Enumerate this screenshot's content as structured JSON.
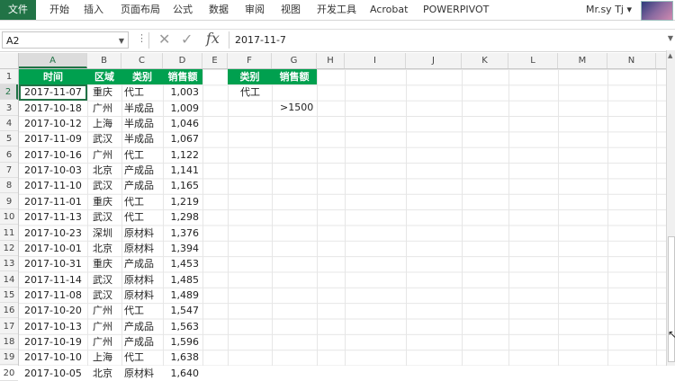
{
  "ribbon": {
    "file_tab": "文件",
    "tabs": [
      "开始",
      "插入",
      "页面布局",
      "公式",
      "数据",
      "审阅",
      "视图",
      "开发工具",
      "Acrobat",
      "POWERPIVOT"
    ],
    "user_name": "Mr.sy Tj",
    "user_caret": "▾",
    "accent_color": "#217346"
  },
  "formula_bar": {
    "name_box": "A2",
    "formula": "2017-11-7"
  },
  "columns": [
    "A",
    "B",
    "C",
    "D",
    "E",
    "F",
    "G",
    "H",
    "I",
    "J",
    "K",
    "L",
    "M",
    "N"
  ],
  "selected_column": "A",
  "selected_row": "2",
  "headers": {
    "time": "时间",
    "region": "区域",
    "category": "类别",
    "sales": "销售额",
    "criteria_category": "类别",
    "criteria_sales": "销售额"
  },
  "criteria": {
    "category_value": "代工",
    "sales_value": ">1500"
  },
  "rows": [
    {
      "n": "2",
      "date": "2017-11-07",
      "region": "重庆",
      "cat": "代工",
      "sales": "1,003"
    },
    {
      "n": "3",
      "date": "2017-10-18",
      "region": "广州",
      "cat": "半成品",
      "sales": "1,009"
    },
    {
      "n": "4",
      "date": "2017-10-12",
      "region": "上海",
      "cat": "半成品",
      "sales": "1,046"
    },
    {
      "n": "5",
      "date": "2017-11-09",
      "region": "武汉",
      "cat": "半成品",
      "sales": "1,067"
    },
    {
      "n": "6",
      "date": "2017-10-16",
      "region": "广州",
      "cat": "代工",
      "sales": "1,122"
    },
    {
      "n": "7",
      "date": "2017-10-03",
      "region": "北京",
      "cat": "产成品",
      "sales": "1,141"
    },
    {
      "n": "8",
      "date": "2017-11-10",
      "region": "武汉",
      "cat": "产成品",
      "sales": "1,165"
    },
    {
      "n": "9",
      "date": "2017-11-01",
      "region": "重庆",
      "cat": "代工",
      "sales": "1,219"
    },
    {
      "n": "10",
      "date": "2017-11-13",
      "region": "武汉",
      "cat": "代工",
      "sales": "1,298"
    },
    {
      "n": "11",
      "date": "2017-10-23",
      "region": "深圳",
      "cat": "原材料",
      "sales": "1,376"
    },
    {
      "n": "12",
      "date": "2017-10-01",
      "region": "北京",
      "cat": "原材料",
      "sales": "1,394"
    },
    {
      "n": "13",
      "date": "2017-10-31",
      "region": "重庆",
      "cat": "产成品",
      "sales": "1,453"
    },
    {
      "n": "14",
      "date": "2017-11-14",
      "region": "武汉",
      "cat": "原材料",
      "sales": "1,485"
    },
    {
      "n": "15",
      "date": "2017-11-08",
      "region": "武汉",
      "cat": "原材料",
      "sales": "1,489"
    },
    {
      "n": "16",
      "date": "2017-10-20",
      "region": "广州",
      "cat": "代工",
      "sales": "1,547"
    },
    {
      "n": "17",
      "date": "2017-10-13",
      "region": "广州",
      "cat": "产成品",
      "sales": "1,563"
    },
    {
      "n": "18",
      "date": "2017-10-19",
      "region": "广州",
      "cat": "产成品",
      "sales": "1,596"
    },
    {
      "n": "19",
      "date": "2017-10-10",
      "region": "上海",
      "cat": "代工",
      "sales": "1,638"
    },
    {
      "n": "20",
      "date": "2017-10-05",
      "region": "北京",
      "cat": "原材料",
      "sales": "1,640"
    }
  ]
}
